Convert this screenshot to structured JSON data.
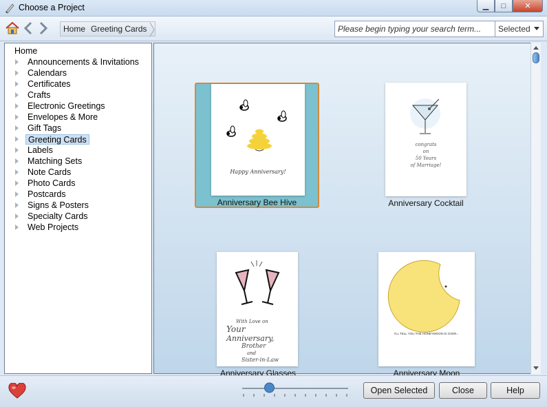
{
  "window": {
    "title": "Choose a Project",
    "minimize": "▁",
    "maximize": "□",
    "close": "✕"
  },
  "toolbar": {
    "breadcrumb": [
      "Home",
      "Greeting Cards"
    ],
    "search_placeholder": "Please begin typing your search term...",
    "filter_value": "Selected"
  },
  "categories": {
    "root": "Home",
    "items": [
      "Announcements & Invitations",
      "Calendars",
      "Certificates",
      "Crafts",
      "Electronic Greetings",
      "Envelopes & More",
      "Gift Tags",
      "Greeting Cards",
      "Labels",
      "Matching Sets",
      "Note Cards",
      "Photo Cards",
      "Postcards",
      "Signs & Posters",
      "Specialty Cards",
      "Web Projects"
    ],
    "selected": "Greeting Cards"
  },
  "projects": [
    {
      "name": "Anniversary Bee Hive",
      "selected": true,
      "card_text": "Happy Anniversary!"
    },
    {
      "name": "Anniversary Cocktail",
      "selected": false,
      "card_text": [
        "congrats",
        "on",
        "50 Years",
        "of Marriage!"
      ]
    },
    {
      "name": "Anniversary Glasses",
      "selected": false,
      "card_text": [
        "With Love on",
        "Your",
        "Anniversary,",
        "Brother",
        "and",
        "Sister-in-Law"
      ]
    },
    {
      "name": "Anniversary Moon",
      "selected": false,
      "card_text": "I'LL TELL YOU THE HONEYMOON IS OVER..."
    }
  ],
  "footer": {
    "open_label": "Open Selected",
    "close_label": "Close",
    "help_label": "Help",
    "zoom_level": 0.25
  },
  "colors": {
    "selection": "#cde1f4",
    "selected_card_bg": "#7cc1cf",
    "selected_card_border": "#d48a3a",
    "hive": "#f4d23a",
    "moon": "#f8e27a"
  }
}
